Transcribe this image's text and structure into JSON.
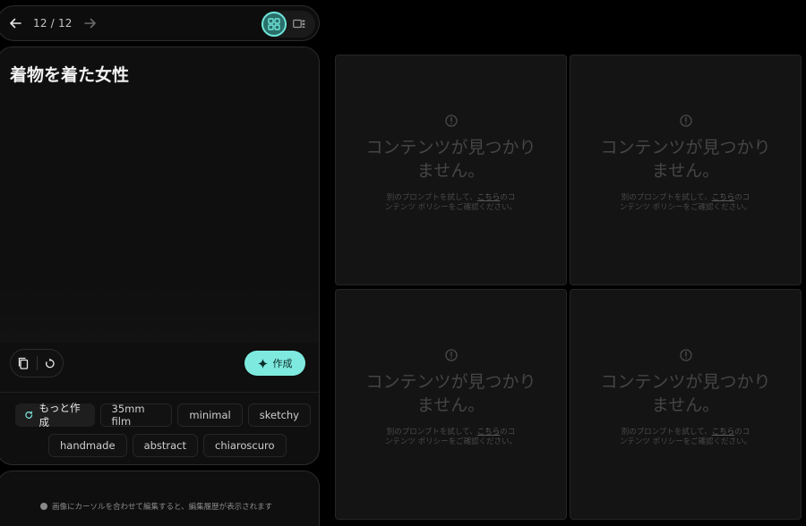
{
  "nav": {
    "counter": "12 / 12"
  },
  "prompt": {
    "title": "着物を着た女性",
    "create_label": "作成"
  },
  "chips": {
    "more": "もっと作成",
    "row1": [
      "35mm film",
      "minimal",
      "sketchy"
    ],
    "row2": [
      "handmade",
      "abstract",
      "chiaroscuro"
    ]
  },
  "hint": {
    "text": "画像にカーソルを合わせて編集すると、編集履歴が表示されます"
  },
  "tiles": [
    {
      "heading": "コンテンツが見つかりません。",
      "body_before": "別のプロンプトを試して、",
      "body_link": "こちら",
      "body_after": "のコンテンツ ポリシーをご確認ください。"
    },
    {
      "heading": "コンテンツが見つかりません。",
      "body_before": "別のプロンプトを試して、",
      "body_link": "こちら",
      "body_after": "のコンテンツ ポリシーをご確認ください。"
    },
    {
      "heading": "コンテンツが見つかりません。",
      "body_before": "別のプロンプトを試して、",
      "body_link": "こちら",
      "body_after": "のコンテンツ ポリシーをご確認ください。"
    },
    {
      "heading": "コンテンツが見つかりません。",
      "body_before": "別のプロンプトを試して、",
      "body_link": "こちら",
      "body_after": "のコンテンツ ポリシーをご確認ください。"
    }
  ],
  "colors": {
    "accent": "#7eeadf",
    "background": "#000000",
    "panel": "#0f0f0f",
    "tile": "#141414"
  },
  "icons": {
    "back": "arrow-left-icon",
    "forward": "arrow-right-icon",
    "grid_view": "grid-view-icon",
    "single_view": "single-view-icon",
    "copy": "copy-icon",
    "reset": "reset-icon",
    "sparkle": "sparkle-icon",
    "refresh": "refresh-icon",
    "info": "info-icon",
    "alert": "alert-circle-icon"
  }
}
